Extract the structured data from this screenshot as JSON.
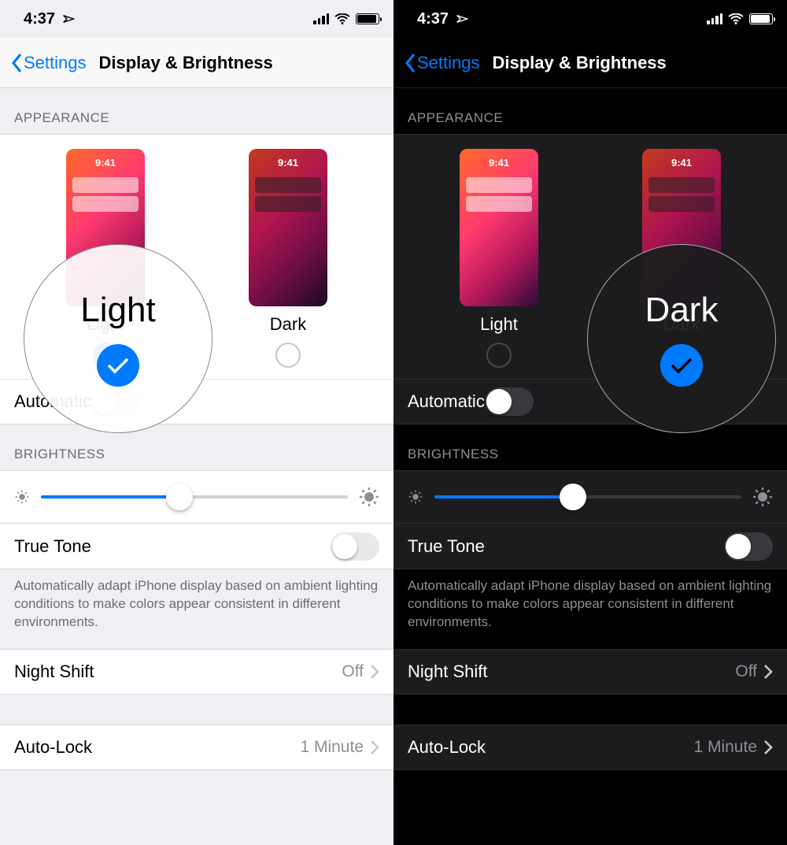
{
  "status": {
    "time": "4:37"
  },
  "nav": {
    "back_label": "Settings",
    "title": "Display & Brightness"
  },
  "appearance": {
    "header": "APPEARANCE",
    "light_label": "Light",
    "dark_label": "Dark",
    "thumb_time": "9:41",
    "automatic_label": "Automatic"
  },
  "brightness": {
    "header": "BRIGHTNESS",
    "slider_percent": 45,
    "true_tone_label": "True Tone",
    "true_tone_desc": "Automatically adapt iPhone display based on ambient lighting conditions to make colors appear consistent in different environments."
  },
  "night_shift": {
    "label": "Night Shift",
    "value": "Off"
  },
  "auto_lock": {
    "label": "Auto-Lock",
    "value": "1 Minute"
  },
  "left": {
    "selected": "light",
    "lens_label": "Light"
  },
  "right": {
    "selected": "dark",
    "lens_label": "Dark"
  }
}
